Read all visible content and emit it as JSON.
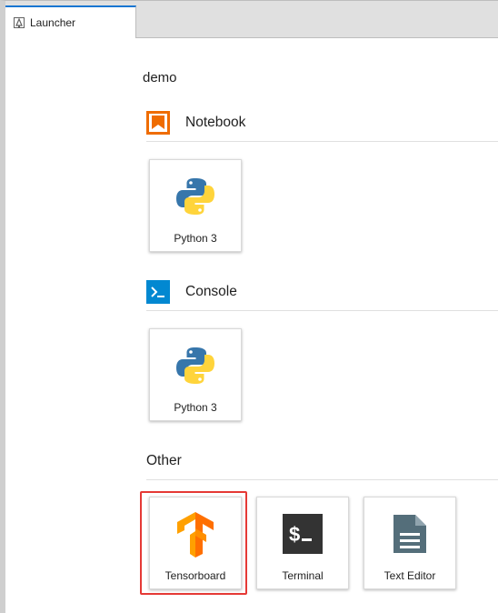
{
  "tab": {
    "title": "Launcher",
    "icon": "launcher-icon"
  },
  "launcher": {
    "app_title": "demo",
    "sections": {
      "notebook": {
        "label": "Notebook",
        "icon": "notebook-icon",
        "items": [
          {
            "label": "Python 3",
            "icon": "python-logo-icon"
          }
        ]
      },
      "console": {
        "label": "Console",
        "icon": "console-icon",
        "items": [
          {
            "label": "Python 3",
            "icon": "python-logo-icon"
          }
        ]
      },
      "other": {
        "label": "Other",
        "items": [
          {
            "label": "Tensorboard",
            "icon": "tensorflow-icon",
            "selected": true
          },
          {
            "label": "Terminal",
            "icon": "terminal-icon"
          },
          {
            "label": "Text Editor",
            "icon": "text-file-icon"
          }
        ]
      }
    }
  },
  "colors": {
    "notebook_accent": "#ef6c00",
    "console_accent": "#0288d1",
    "highlight_border": "#e53935",
    "tensorflow_orange": "#ff6f00",
    "terminal_bg": "#333333",
    "text_file_gray": "#546e7a"
  }
}
